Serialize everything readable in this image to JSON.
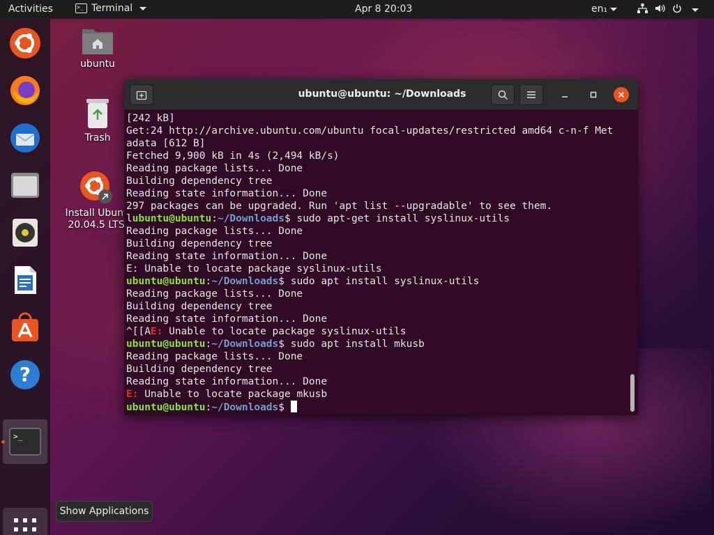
{
  "topbar": {
    "activities": "Activities",
    "app_name": "Terminal",
    "clock": "Apr 8  20:03",
    "lang": "en₁"
  },
  "dock": {
    "items": [
      {
        "name": "ubuntu-installer"
      },
      {
        "name": "firefox"
      },
      {
        "name": "thunderbird"
      },
      {
        "name": "files"
      },
      {
        "name": "rhythmbox"
      },
      {
        "name": "libreoffice-writer"
      },
      {
        "name": "ubuntu-software"
      },
      {
        "name": "help"
      },
      {
        "name": "terminal"
      }
    ]
  },
  "desktop": {
    "home_label": "ubuntu",
    "trash_label": "Trash",
    "install_label_1": "Install Ubunt",
    "install_label_2": "20.04.5 LTS"
  },
  "tooltip": "Show Applications",
  "terminal": {
    "title": "ubuntu@ubuntu: ~/Downloads",
    "prompt_user": "ubuntu@ubuntu",
    "prompt_path": "~/Downloads",
    "lines": [
      {
        "type": "text",
        "text": "[242 kB]"
      },
      {
        "type": "text",
        "text": "Get:24 http://archive.ubuntu.com/ubuntu focal-updates/restricted amd64 c-n-f Met"
      },
      {
        "type": "text",
        "text": "adata [612 B]"
      },
      {
        "type": "text",
        "text": "Fetched 9,900 kB in 4s (2,494 kB/s)"
      },
      {
        "type": "text",
        "text": "Reading package lists... Done"
      },
      {
        "type": "text",
        "text": "Building dependency tree"
      },
      {
        "type": "text",
        "text": "Reading state information... Done"
      },
      {
        "type": "text",
        "text": "297 packages can be upgraded. Run 'apt list --upgradable' to see them."
      },
      {
        "type": "prompt",
        "prefix": "l",
        "user": "ubuntu@ubuntu",
        "path": "~/Downloads",
        "cmd": "$ sudo apt-get install syslinux-utils"
      },
      {
        "type": "text",
        "text": "Reading package lists... Done"
      },
      {
        "type": "text",
        "text": "Building dependency tree"
      },
      {
        "type": "text",
        "text": "Reading state information... Done"
      },
      {
        "type": "text",
        "text": "E: Unable to locate package syslinux-utils"
      },
      {
        "type": "prompt",
        "prefix": "",
        "user": "ubuntu@ubuntu",
        "path": "~/Downloads",
        "cmd": "$ sudo apt install syslinux-utils"
      },
      {
        "type": "text",
        "text": "Reading package lists... Done"
      },
      {
        "type": "text",
        "text": "Building dependency tree"
      },
      {
        "type": "text",
        "text": "Reading state information... Done"
      },
      {
        "type": "error",
        "prefix": "^[[A",
        "err": "E:",
        "text": " Unable to locate package syslinux-utils"
      },
      {
        "type": "prompt",
        "prefix": "",
        "user": "ubuntu@ubuntu",
        "path": "~/Downloads",
        "cmd": "$ sudo apt install mkusb"
      },
      {
        "type": "text",
        "text": "Reading package lists... Done"
      },
      {
        "type": "text",
        "text": "Building dependency tree"
      },
      {
        "type": "text",
        "text": "Reading state information... Done"
      },
      {
        "type": "error",
        "prefix": "",
        "err": "E:",
        "text": " Unable to locate package mkusb"
      },
      {
        "type": "prompt",
        "prefix": "",
        "user": "ubuntu@ubuntu",
        "path": "~/Downloads",
        "cmd": "$ ",
        "cursor": true
      }
    ]
  },
  "colors": {
    "terminal_bg": "#300a24",
    "prompt_user": "#8ae234",
    "prompt_path": "#729fcf",
    "error": "#ef2929",
    "accent": "#e95420"
  }
}
